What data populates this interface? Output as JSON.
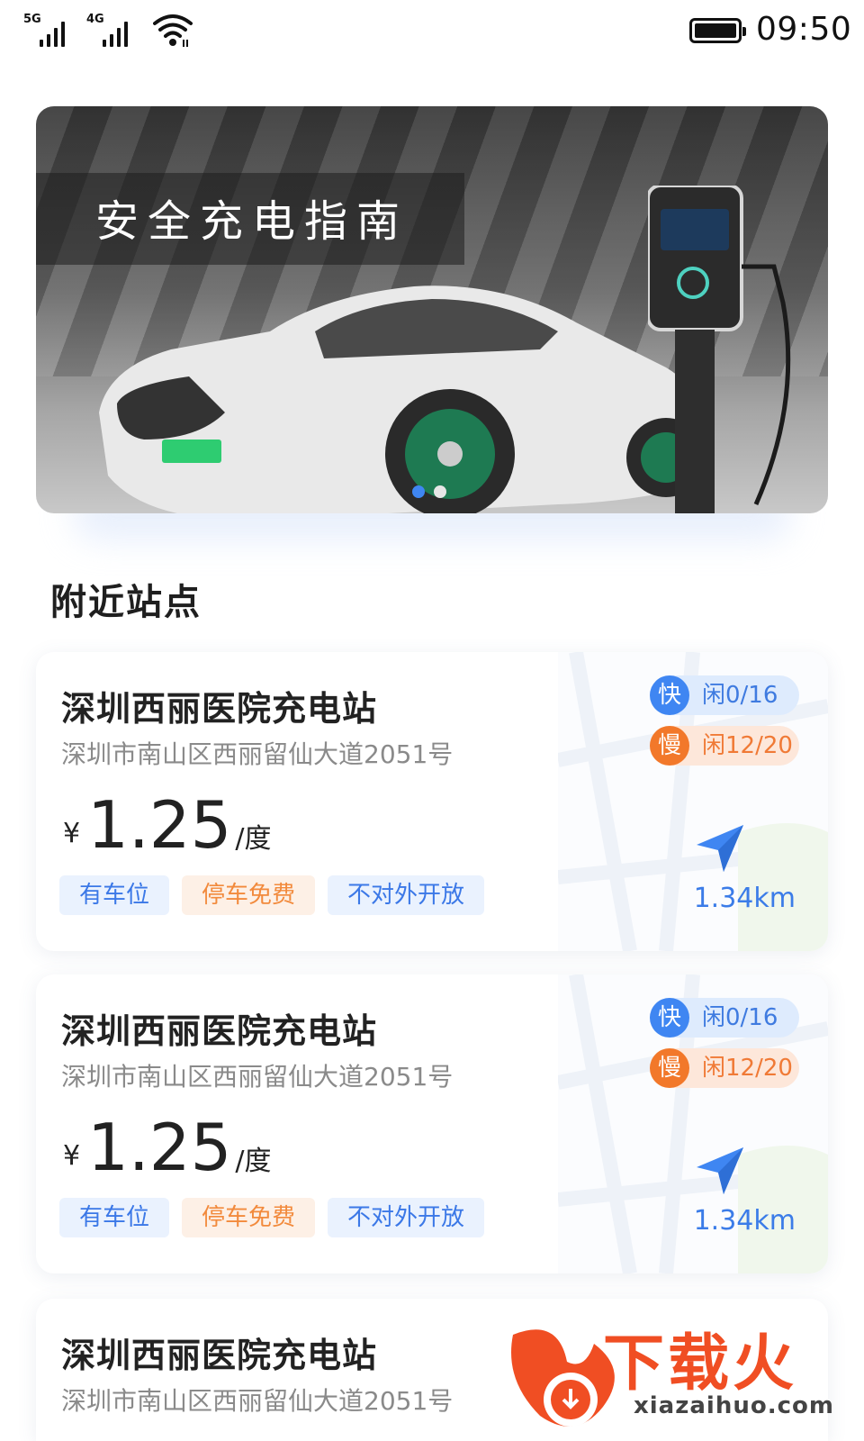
{
  "status_bar": {
    "signal1_label": "5G",
    "signal2_label": "4G",
    "time": "09:50",
    "icons": [
      "signal-5g-icon",
      "signal-4g-icon",
      "wifi-icon",
      "battery-icon"
    ]
  },
  "banner": {
    "title": "安全充电指南",
    "page_count": 2,
    "active_index": 0
  },
  "nearby": {
    "title": "附近站点",
    "stations": [
      {
        "name": "深圳西丽医院充电站",
        "address": "深圳市南山区西丽留仙大道2051号",
        "currency": "¥",
        "price": "1.25",
        "unit": "/度",
        "tags": [
          "有车位",
          "停车免费",
          "不对外开放"
        ],
        "fast_label": "快",
        "fast_count": "闲0/16",
        "slow_label": "慢",
        "slow_count": "闲12/20",
        "distance": "1.34km"
      },
      {
        "name": "深圳西丽医院充电站",
        "address": "深圳市南山区西丽留仙大道2051号",
        "currency": "¥",
        "price": "1.25",
        "unit": "/度",
        "tags": [
          "有车位",
          "停车免费",
          "不对外开放"
        ],
        "fast_label": "快",
        "fast_count": "闲0/16",
        "slow_label": "慢",
        "slow_count": "闲12/20",
        "distance": "1.34km"
      },
      {
        "name": "深圳西丽医院充电站",
        "address": "深圳市南山区西丽留仙大道2051号"
      }
    ]
  },
  "watermark": {
    "brand": "下载火",
    "url": "xiazaihuo.com"
  },
  "colors": {
    "accent_blue": "#3f86f2",
    "accent_orange": "#f2782a",
    "watermark_red": "#f04e23"
  }
}
